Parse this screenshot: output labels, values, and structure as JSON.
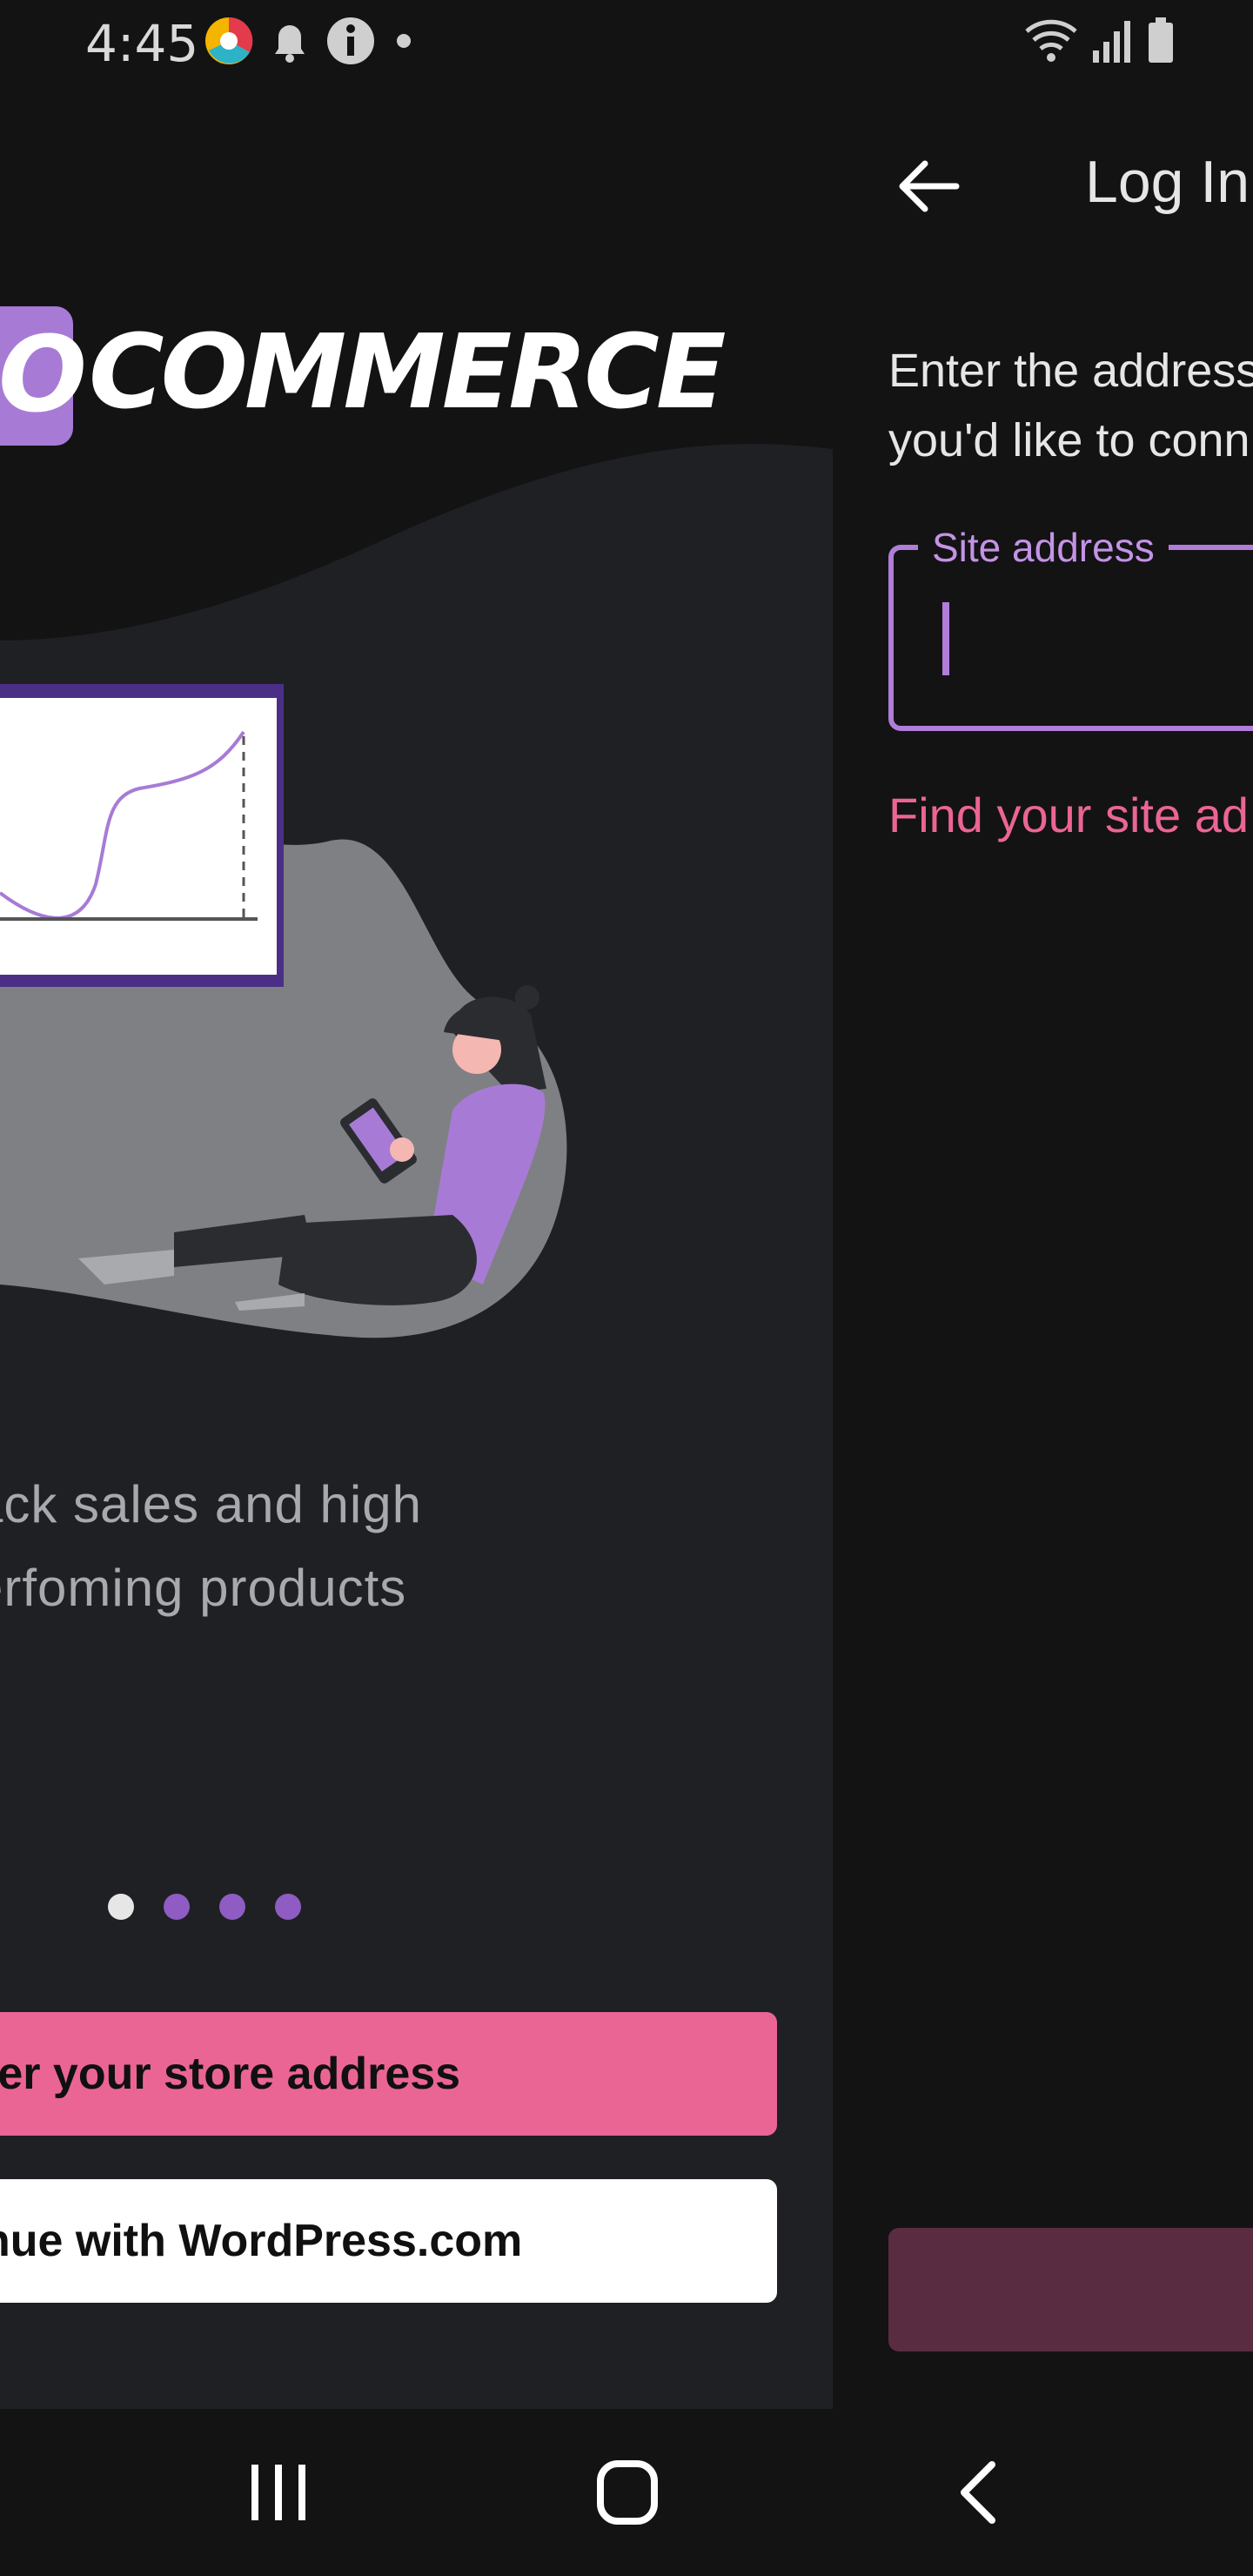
{
  "status_bar": {
    "time": "4:45",
    "icons_left": [
      "chrome-like-app-icon",
      "notification-bell-icon",
      "info-icon",
      "dot-icon"
    ],
    "icons_right": [
      "wifi-icon",
      "signal-icon",
      "battery-icon"
    ]
  },
  "onboarding": {
    "logo_letter": "O",
    "logo_text": "COMMERCE",
    "tagline": "ack sales and high\nerfoming products",
    "pager": {
      "count": 4,
      "active_index": 0
    },
    "primary_button_label": "ter your store address",
    "secondary_button_label": "nue with WordPress.com",
    "colors": {
      "primary": "#eb6594",
      "accent": "#8e5cc2",
      "panel": "#1e2024"
    }
  },
  "login": {
    "title": "Log In",
    "prompt_line1": "Enter the address",
    "prompt_line2": "you'd like to conn",
    "field_label": "Site address",
    "field_value": "",
    "find_link": "Find your site ad",
    "colors": {
      "field_border": "#b07dd8",
      "link": "#eb6594",
      "button_disabled": "#5a2c41"
    }
  },
  "nav_bar": {
    "icons": [
      "recent-apps-icon",
      "home-icon",
      "back-icon"
    ]
  }
}
